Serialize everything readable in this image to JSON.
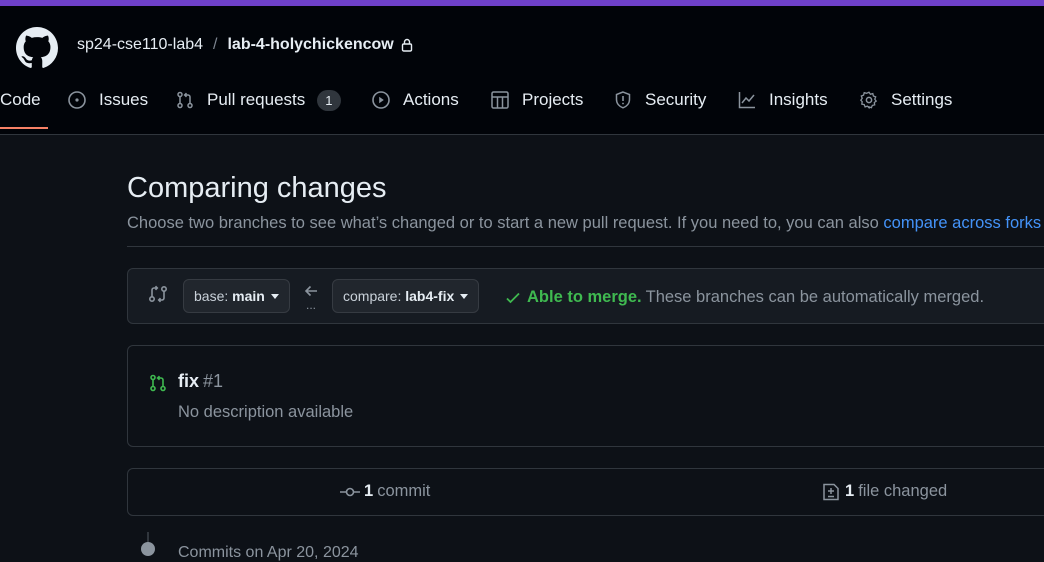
{
  "breadcrumb": {
    "owner": "sp24-cse110-lab4",
    "separator": "/",
    "repo": "lab-4-holychickencow"
  },
  "tabs": [
    {
      "label": "Code",
      "icon": "code-icon",
      "active": true
    },
    {
      "label": "Issues",
      "icon": "issue-icon"
    },
    {
      "label": "Pull requests",
      "icon": "pull-request-icon",
      "count": "1"
    },
    {
      "label": "Actions",
      "icon": "play-icon"
    },
    {
      "label": "Projects",
      "icon": "table-icon"
    },
    {
      "label": "Security",
      "icon": "shield-icon"
    },
    {
      "label": "Insights",
      "icon": "graph-icon"
    },
    {
      "label": "Settings",
      "icon": "gear-icon"
    }
  ],
  "page": {
    "title": "Comparing changes",
    "subtitle_text": "Choose two branches to see what’s changed or to start a new pull request. If you need to, you can also ",
    "subtitle_link": "compare across forks"
  },
  "range": {
    "base_prefix": "base:",
    "base_branch": "main",
    "compare_prefix": "compare:",
    "compare_branch": "lab4-fix",
    "dots": "...",
    "merge_status": "Able to merge.",
    "merge_detail": "These branches can be automatically merged."
  },
  "pull_request": {
    "title": "fix",
    "number": "#1",
    "description": "No description available"
  },
  "stats": {
    "commits_count": "1",
    "commits_label": "commit",
    "files_count": "1",
    "files_label": "file changed"
  },
  "timeline": {
    "commits_on": "Commits on Apr 20, 2024"
  },
  "colors": {
    "accent_strip": "#6e40c9",
    "success": "#3fb950",
    "link": "#4493f8",
    "active_tab_underline": "#f78166"
  }
}
